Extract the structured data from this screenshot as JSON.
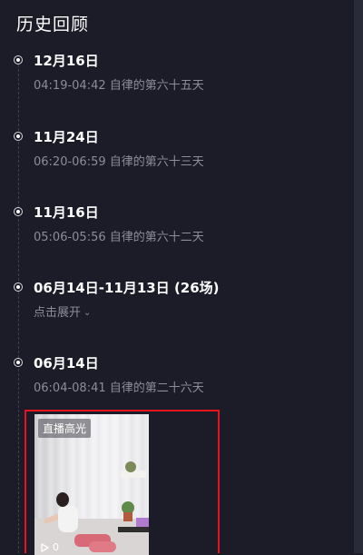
{
  "header": {
    "title": "历史回顾"
  },
  "entries": [
    {
      "date": "12月16日",
      "subtitle": "04:19-04:42 自律的第六十五天"
    },
    {
      "date": "11月24日",
      "subtitle": "06:20-06:59 自律的第六十三天"
    },
    {
      "date": "11月16日",
      "subtitle": "05:06-05:56 自律的第六十二天"
    },
    {
      "date": "06月14日-11月13日 (26场)",
      "expand_label": "点击展开"
    },
    {
      "date": "06月14日",
      "subtitle": "06:04-08:41 自律的第二十六天"
    }
  ],
  "video": {
    "badge": "直播高光",
    "play_count": "0",
    "highlight_color": "#e3141e"
  },
  "colors": {
    "background": "#1b1c28",
    "subtext": "#8c8d98"
  }
}
